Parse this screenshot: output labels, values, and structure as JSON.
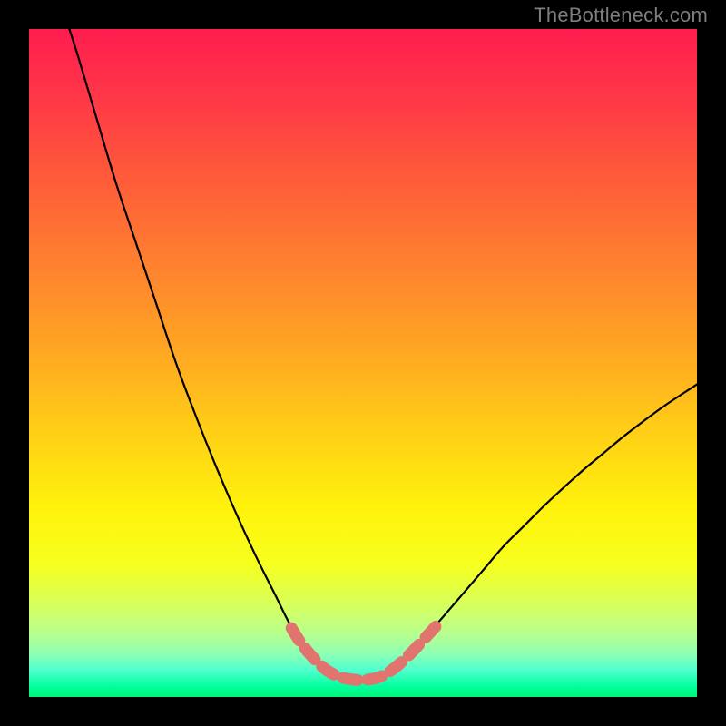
{
  "watermark": "TheBottleneck.com",
  "chart_data": {
    "type": "line",
    "title": "",
    "xlabel": "",
    "ylabel": "",
    "xlim": [
      0,
      100
    ],
    "ylim": [
      0,
      100
    ],
    "grid": false,
    "legend": false,
    "series": [
      {
        "name": "curve",
        "xy": [
          [
            5,
            103
          ],
          [
            7,
            97
          ],
          [
            10,
            87
          ],
          [
            13,
            77
          ],
          [
            16,
            68
          ],
          [
            19,
            59
          ],
          [
            22,
            50
          ],
          [
            25,
            42
          ],
          [
            28,
            34.5
          ],
          [
            31,
            27.5
          ],
          [
            34,
            21
          ],
          [
            37,
            15
          ],
          [
            39,
            11
          ],
          [
            41,
            8
          ],
          [
            42.5,
            6
          ],
          [
            44,
            4.5
          ],
          [
            45.2,
            3.5
          ],
          [
            46.3,
            3
          ],
          [
            47.3,
            2.7
          ],
          [
            48.4,
            2.55
          ],
          [
            49.5,
            2.5
          ],
          [
            50.5,
            2.55
          ],
          [
            51.6,
            2.7
          ],
          [
            52.5,
            3
          ],
          [
            53.5,
            3.5
          ],
          [
            54.5,
            4.2
          ],
          [
            56,
            5.5
          ],
          [
            57.5,
            7
          ],
          [
            59.5,
            9.2
          ],
          [
            62,
            12
          ],
          [
            65,
            15.5
          ],
          [
            68,
            19
          ],
          [
            71,
            22.5
          ],
          [
            74,
            25.5
          ],
          [
            77,
            28.5
          ],
          [
            80,
            31.3
          ],
          [
            83,
            34
          ],
          [
            86,
            36.5
          ],
          [
            89,
            39
          ],
          [
            92,
            41.3
          ],
          [
            95,
            43.5
          ],
          [
            98,
            45.5
          ],
          [
            100,
            46.8
          ]
        ]
      }
    ],
    "highlight_segments": [
      {
        "xy": [
          [
            39.3,
            10.3
          ],
          [
            40.5,
            8.4
          ],
          [
            41.8,
            6.7
          ],
          [
            43.1,
            5.3
          ],
          [
            44.3,
            4.2
          ],
          [
            45.4,
            3.5
          ],
          [
            46.5,
            3.0
          ],
          [
            47.8,
            2.7
          ],
          [
            49.0,
            2.55
          ],
          [
            50.2,
            2.55
          ],
          [
            51.4,
            2.7
          ],
          [
            52.5,
            3.0
          ],
          [
            53.5,
            3.5
          ],
          [
            54.4,
            4.1
          ],
          [
            55.3,
            4.8
          ],
          [
            56.5,
            5.9
          ],
          [
            57.7,
            7.1
          ],
          [
            58.9,
            8.4
          ],
          [
            60.1,
            9.7
          ],
          [
            61.2,
            10.9
          ]
        ]
      }
    ],
    "gradient_stops": [
      {
        "offset": 0,
        "color": "#ff1d4f"
      },
      {
        "offset": 0.1,
        "color": "#ff3648"
      },
      {
        "offset": 0.22,
        "color": "#ff5a3a"
      },
      {
        "offset": 0.35,
        "color": "#ff8030"
      },
      {
        "offset": 0.48,
        "color": "#ffa623"
      },
      {
        "offset": 0.6,
        "color": "#ffce17"
      },
      {
        "offset": 0.72,
        "color": "#fff30b"
      },
      {
        "offset": 0.8,
        "color": "#f7ff1e"
      },
      {
        "offset": 0.86,
        "color": "#d8ff5a"
      },
      {
        "offset": 0.905,
        "color": "#b8ff8e"
      },
      {
        "offset": 0.935,
        "color": "#8fffb4"
      },
      {
        "offset": 0.96,
        "color": "#4fffce"
      },
      {
        "offset": 0.985,
        "color": "#00ff9a"
      },
      {
        "offset": 1.0,
        "color": "#00f57a"
      }
    ],
    "highlight_color": "#e2746f",
    "curve_color": "#000000"
  }
}
